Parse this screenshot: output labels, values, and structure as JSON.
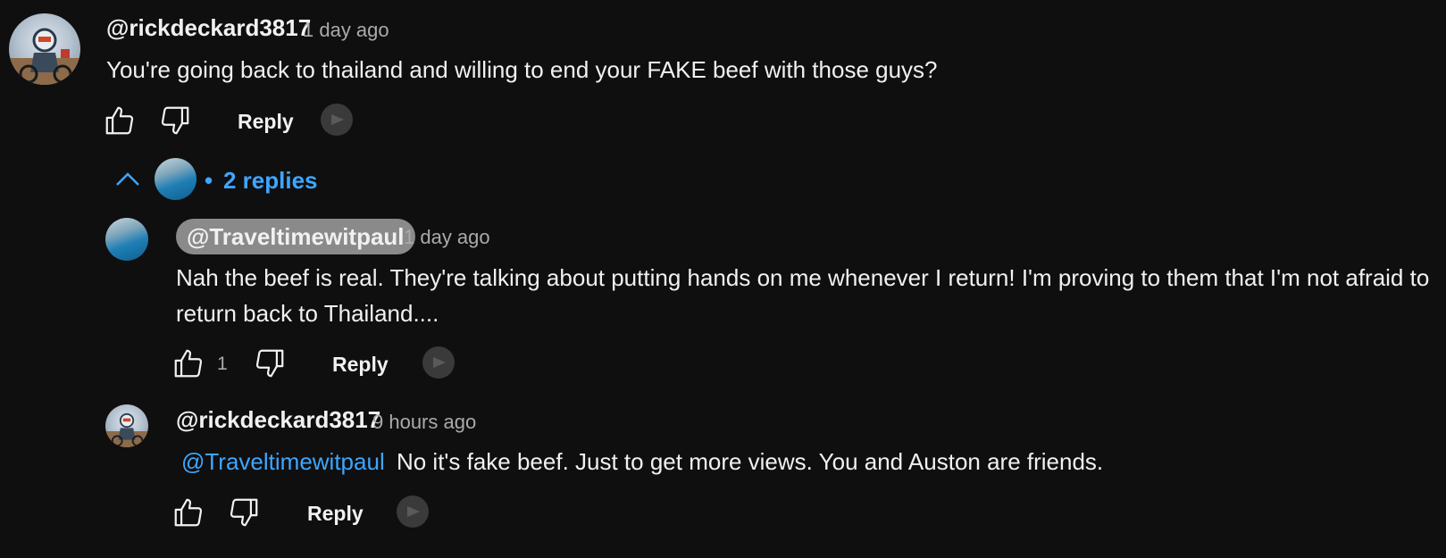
{
  "comments": [
    {
      "author": "@rickdeckard3817",
      "time": "1 day ago",
      "text": "You're going back to thailand and willing to end your FAKE beef with those guys?",
      "reply_label": "Reply"
    }
  ],
  "replies_toggle": {
    "label": "2 replies",
    "separator": "•"
  },
  "replies": [
    {
      "author": "@Traveltimewitpaul",
      "time": "1 day ago",
      "text": "Nah the beef is real. They're talking about putting hands on me whenever I return! I'm proving to them that I'm not afraid to return back to Thailand....",
      "like_count": "1",
      "reply_label": "Reply"
    },
    {
      "author": "@rickdeckard3817",
      "time": "9 hours ago",
      "mention": "@Traveltimewitpaul",
      "text": "No it's fake beef. Just to get more views. You and Auston are friends.",
      "reply_label": "Reply"
    }
  ],
  "icons": {
    "like": "thumbs-up-icon",
    "dislike": "thumbs-down-icon",
    "badge": "iq-badge-icon",
    "collapse": "chevron-up-icon"
  },
  "colors": {
    "background": "#0f0f0f",
    "text": "#f1f1f1",
    "secondary": "#aaaaaa",
    "link": "#3ea6ff",
    "creator_pill": "#8a8a8a"
  }
}
